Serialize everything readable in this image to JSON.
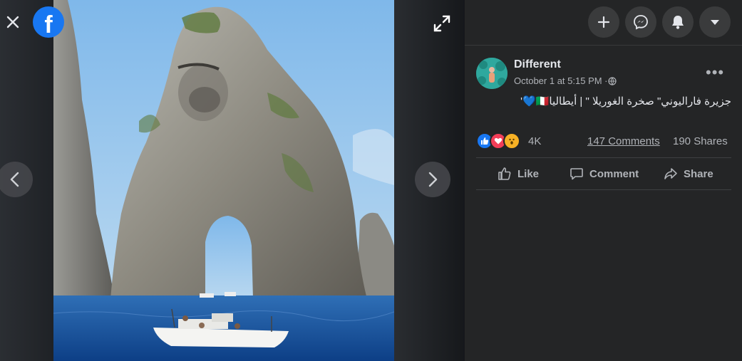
{
  "viewer": {
    "brand_letter": "f",
    "close_icon": "close-icon",
    "expand_icon": "expand-icon",
    "prev_icon": "chevron-left-icon",
    "next_icon": "chevron-right-icon"
  },
  "topbar": {
    "buttons": [
      "plus-icon",
      "messenger-icon",
      "bell-icon",
      "caret-down-icon"
    ]
  },
  "post": {
    "author": "Different",
    "timestamp": "October 1 at 5:15 PM · ",
    "privacy_icon": "globe-icon",
    "more_label": "•••",
    "text": "جزيرة فاراليوني\" صخرة الغوريلا \" | أيطاليا🇮🇹💙'",
    "reaction_count": "4K",
    "comments": "147 Comments",
    "shares": "190 Shares"
  },
  "actions": {
    "like": "Like",
    "comment": "Comment",
    "share": "Share"
  },
  "colors": {
    "accent": "#1877f2",
    "panel": "#242526",
    "text": "#e4e6eb",
    "subtext": "#b0b3b8",
    "love": "#f33e58",
    "wow": "#f7b125"
  }
}
